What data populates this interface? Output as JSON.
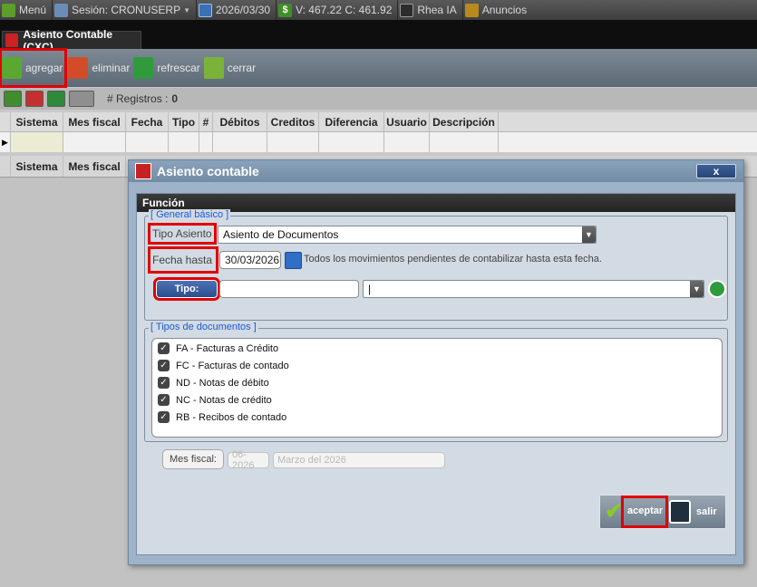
{
  "topbar": {
    "menu": "Menú",
    "session": "Sesión: CRONUSERP",
    "date": "2026/03/30",
    "balance": "V: 467.22 C: 461.92",
    "rhea": "Rhea IA",
    "anuncios": "Anuncios"
  },
  "tab": {
    "title": "Asiento Contable (CXC)"
  },
  "toolbar": {
    "agregar": "agregar",
    "eliminar": "eliminar",
    "refrescar": "refrescar",
    "cerrar": "cerrar"
  },
  "subbar": {
    "registros_label": "# Registros :",
    "registros_count": "0"
  },
  "grid1": {
    "columns": [
      "Sistema",
      "Mes fiscal",
      "Fecha",
      "Tipo",
      "#",
      "Débitos",
      "Creditos",
      "Diferencia",
      "Usuario",
      "Descripción"
    ]
  },
  "grid2": {
    "columns": [
      "Sistema",
      "Mes fiscal"
    ]
  },
  "modal": {
    "title": "Asiento contable",
    "close": "x",
    "funcion": "Función",
    "general_legend": "[ General básico ]",
    "tipo_asiento_label": "Tipo Asiento",
    "tipo_asiento_value": "Asiento de Documentos",
    "fecha_hasta_label": "Fecha hasta",
    "fecha_hasta_value": "30/03/2026",
    "fecha_note": "Todos los movimientos pendientes de contabilizar hasta esta fecha.",
    "tipo_button": "Tipo:",
    "tipo_text": "",
    "tipo_select": "|",
    "docs_legend": "[ Tipos de documentos ]",
    "docs": [
      {
        "label": "FA - Facturas a Crédito",
        "checked": true
      },
      {
        "label": "FC - Facturas de contado",
        "checked": true
      },
      {
        "label": "ND - Notas de débito",
        "checked": true
      },
      {
        "label": "NC - Notas de crédito",
        "checked": true
      },
      {
        "label": "RB - Recibos de contado",
        "checked": true
      }
    ],
    "mes_fiscal_button": "Mes fiscal:",
    "mes_fiscal_code": "06-2026",
    "mes_fiscal_desc": "Marzo del 2026",
    "aceptar": "aceptar",
    "salir": "salir"
  }
}
